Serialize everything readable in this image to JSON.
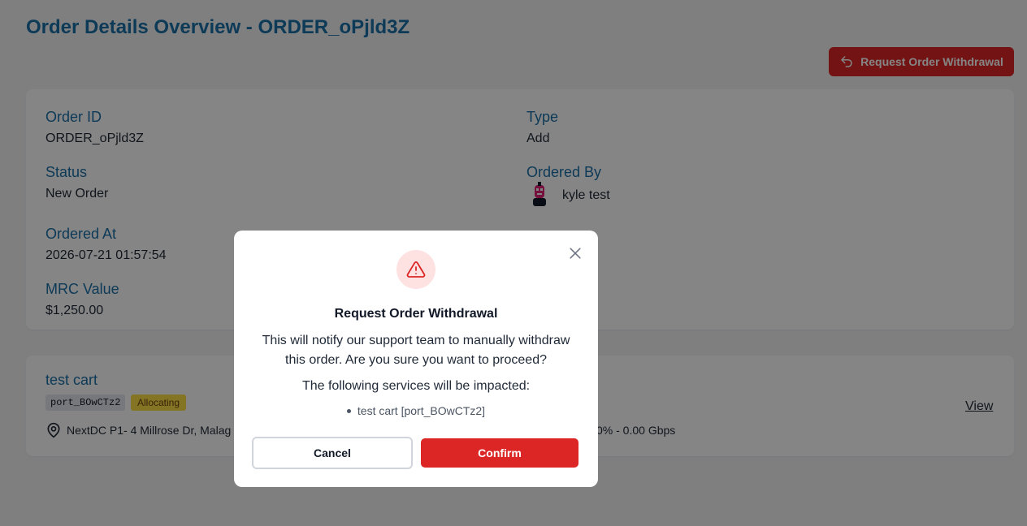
{
  "page": {
    "title": "Order Details Overview - ORDER_oPjld3Z",
    "withdraw_button": "Request Order Withdrawal"
  },
  "details": {
    "order_id": {
      "label": "Order ID",
      "value": "ORDER_oPjld3Z"
    },
    "type": {
      "label": "Type",
      "value": "Add"
    },
    "status": {
      "label": "Status",
      "value": "New Order"
    },
    "ordered_by": {
      "label": "Ordered By",
      "value": "kyle test"
    },
    "ordered_at": {
      "label": "Ordered At",
      "value": "2026-07-21 01:57:54"
    },
    "mrc_value": {
      "label": "MRC Value",
      "value": "$1,250.00"
    }
  },
  "service": {
    "name": "test cart",
    "port_id": "port_BOwCTz2",
    "status": "Allocating",
    "location": "NextDC P1- 4 Millrose Dr, Malag",
    "speed": "0% - 0.00 Gbps",
    "view_label": "View"
  },
  "modal": {
    "title": "Request Order Withdrawal",
    "description": "This will notify our support team to manually withdraw this order. Are you sure you want to proceed?",
    "impact_text": "The following services will be impacted:",
    "impacted_item": "test cart [port_BOwCTz2]",
    "cancel_label": "Cancel",
    "confirm_label": "Confirm"
  },
  "colors": {
    "accent_blue": "#1a6fa8",
    "danger_red": "#dc2626",
    "status_yellow": "#fde047"
  },
  "icons": [
    "undo-arrow-icon",
    "map-pin-icon",
    "alert-triangle-icon",
    "close-icon"
  ]
}
